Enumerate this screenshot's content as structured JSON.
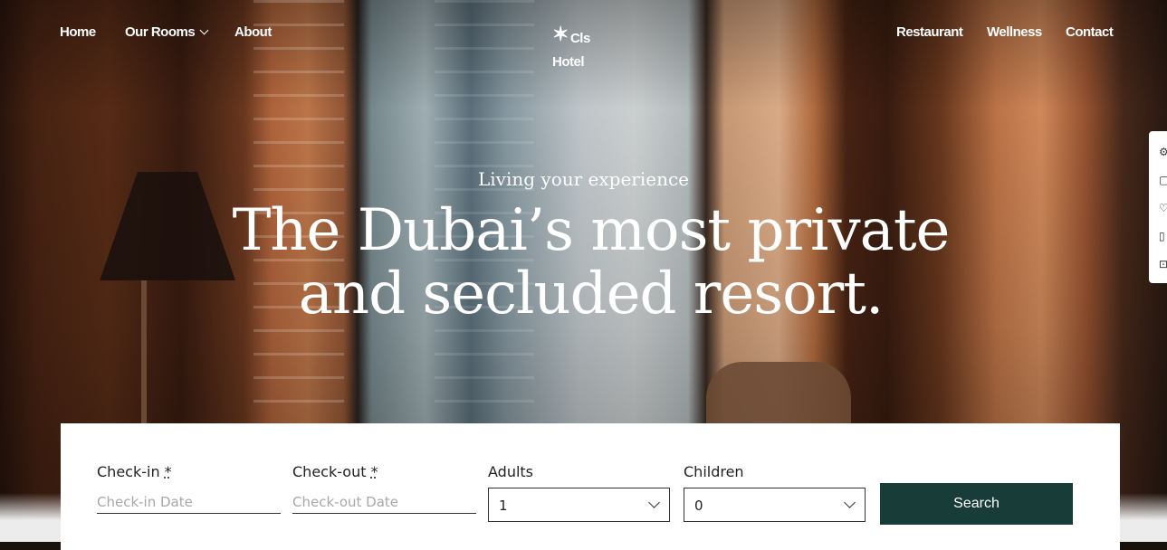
{
  "nav": {
    "home": "Home",
    "rooms": "Our Rooms",
    "about": "About",
    "restaurant": "Restaurant",
    "wellness": "Wellness",
    "contact": "Contact"
  },
  "logo": {
    "line1": "Cls",
    "line2": "Hotel"
  },
  "hero": {
    "tagline": "Living your experience",
    "headline_line1": "The Dubai’s most private",
    "headline_line2": "and secluded resort."
  },
  "booking": {
    "checkin_label": "Check-in",
    "checkin_placeholder": "Check-in Date",
    "checkout_label": "Check-out",
    "checkout_placeholder": "Check-out Date",
    "required_mark": "*",
    "adults_label": "Adults",
    "adults_value": "1",
    "children_label": "Children",
    "children_value": "0",
    "search_label": "Search"
  },
  "colors": {
    "search_button": "#183c38",
    "text_light": "#ffffff"
  },
  "icons": [
    "gear-icon",
    "chat-icon",
    "heart-icon",
    "document-icon",
    "cart-icon"
  ]
}
